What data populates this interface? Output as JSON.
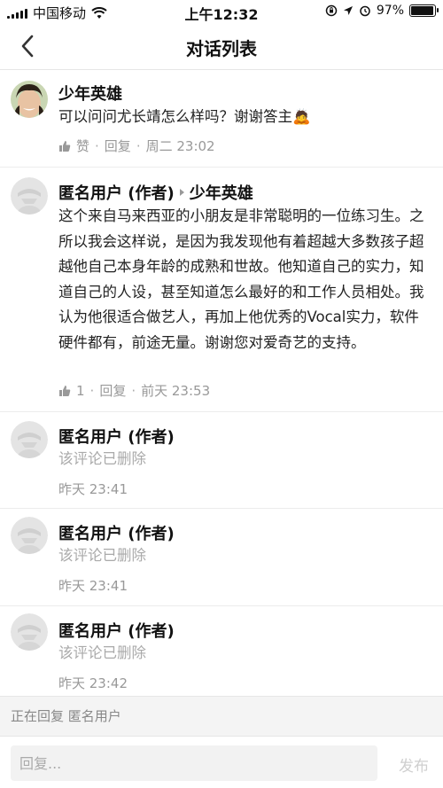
{
  "status_bar": {
    "carrier": "中国移动",
    "time": "上午12:32",
    "battery": "97%"
  },
  "nav": {
    "title": "对话列表"
  },
  "comments": [
    {
      "author": "少年英雄",
      "text": "可以问问尤长靖怎么样吗？谢谢答主🙇",
      "like_label": "赞",
      "reply_label": "回复",
      "time": "周二 23:02"
    },
    {
      "author": "匿名用户 (作者)",
      "reply_to": "少年英雄",
      "text": "这个来自马来西亚的小朋友是非常聪明的一位练习生。之所以我会这样说，是因为我发现他有着超越大多数孩子超越他自己本身年龄的成熟和世故。他知道自己的实力，知道自己的人设，甚至知道怎么最好的和工作人员相处。我认为他很适合做艺人，再加上他优秀的Vocal实力，软件硬件都有，前途无量。谢谢您对爱奇艺的支持。",
      "like_count": "1",
      "reply_label": "回复",
      "time": "前天 23:53"
    },
    {
      "author": "匿名用户 (作者)",
      "text": "该评论已删除",
      "time": "昨天 23:41"
    },
    {
      "author": "匿名用户 (作者)",
      "text": "该评论已删除",
      "time": "昨天 23:41"
    },
    {
      "author": "匿名用户 (作者)",
      "text": "该评论已删除",
      "time": "昨天 23:42"
    }
  ],
  "replying_to": "正在回复 匿名用户",
  "input": {
    "placeholder": "回复...",
    "send_label": "发布"
  }
}
